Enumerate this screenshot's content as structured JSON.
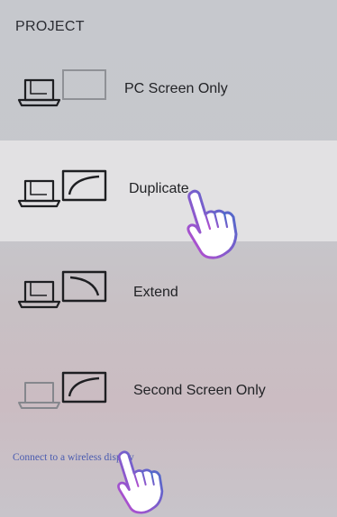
{
  "header": {
    "title": "PROJECT"
  },
  "options": [
    {
      "label": "PC Screen Only",
      "selected": false,
      "laptop_icon": "laptop-icon",
      "screen_icon": "screen-blank-icon"
    },
    {
      "label": "Duplicate",
      "selected": true,
      "laptop_icon": "laptop-icon",
      "screen_icon": "screen-icon"
    },
    {
      "label": "Extend",
      "selected": false,
      "laptop_icon": "laptop-icon",
      "screen_icon": "screen-icon"
    },
    {
      "label": "Second Screen Only",
      "selected": false,
      "laptop_icon": "laptop-icon",
      "screen_icon": "screen-icon"
    }
  ],
  "footer": {
    "wireless_link": "Connect to a wireless display"
  },
  "colors": {
    "panel_background": "#c6c8cd",
    "selected_row": "#e2e1e3",
    "link": "#4a5bb0",
    "cursor_outline_start": "#3a70c8",
    "cursor_outline_end": "#c04ad0"
  },
  "cursors": [
    "hand-pointer-icon",
    "hand-pointer-icon"
  ]
}
